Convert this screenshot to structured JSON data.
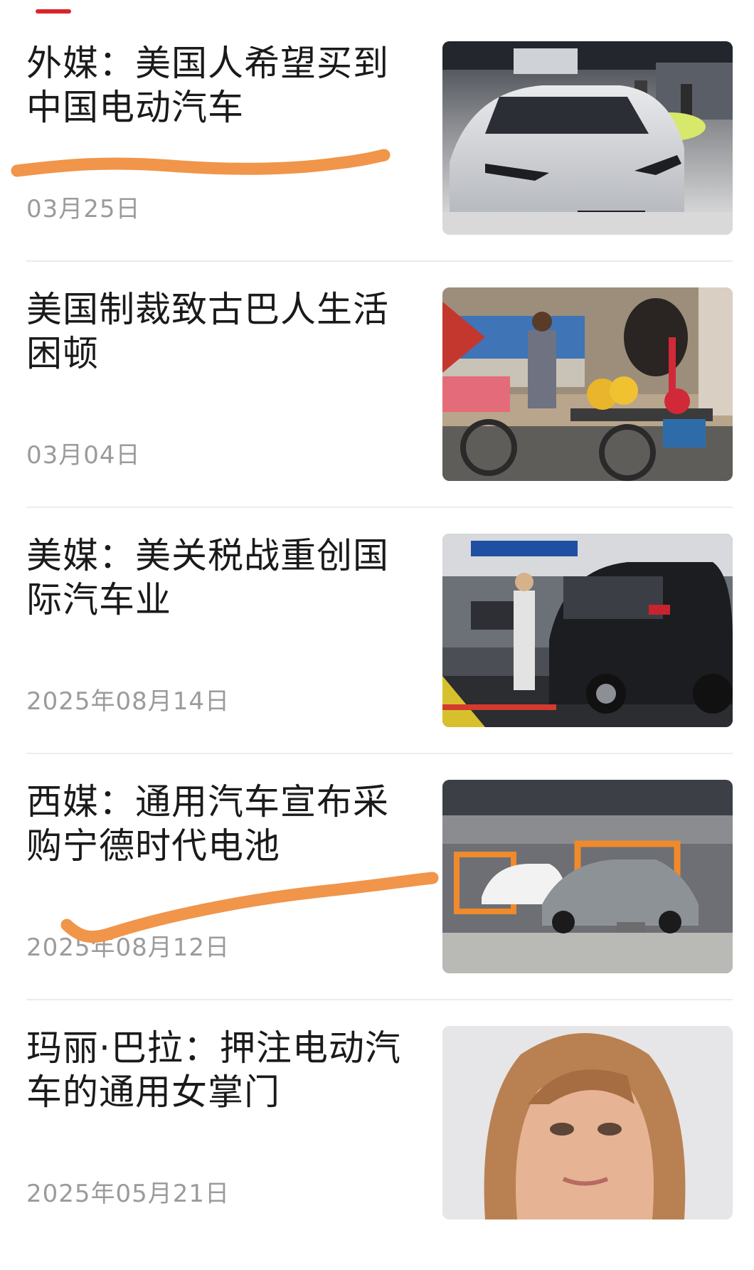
{
  "news": [
    {
      "title": "外媒：美国人希望买到中国电动汽车",
      "date": "03月25日",
      "image": "byd-car-photo"
    },
    {
      "title": "美国制裁致古巴人生活困顿",
      "date": "03月04日",
      "image": "cuba-flower-cart-photo"
    },
    {
      "title": "美媒：美关税战重创国际汽车业",
      "date": "2025年08月14日",
      "image": "assembly-line-photo"
    },
    {
      "title": "西媒：通用汽车宣布采购宁德时代电池",
      "date": "2025年08月12日",
      "image": "gm-factory-photo"
    },
    {
      "title": "玛丽·巴拉：押注电动汽车的通用女掌门",
      "date": "2025年05月21日",
      "image": "portrait-photo"
    }
  ],
  "colors": {
    "accent": "#d9252b",
    "title": "#1a1a1a",
    "date": "#9b9b9b",
    "annotation_stroke": "#f0954a",
    "divider": "#ececec"
  }
}
